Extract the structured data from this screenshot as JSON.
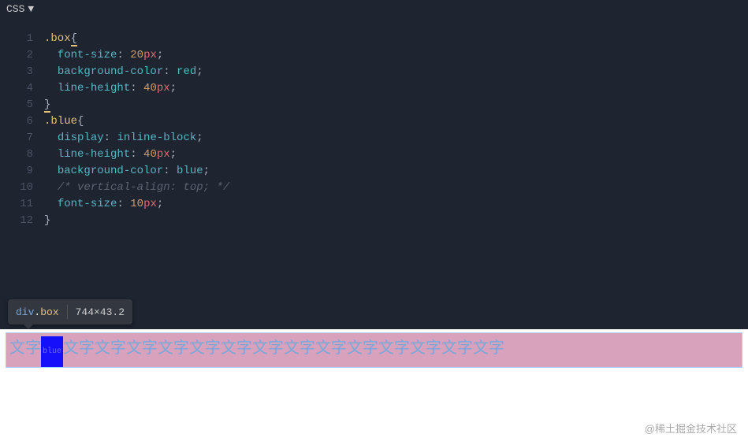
{
  "header": {
    "lang": "CSS",
    "dropdown_icon": "▼"
  },
  "code": {
    "lines_count": 12,
    "l1": {
      "sel": ".box",
      "brace": "{"
    },
    "l2": {
      "prop": "font-size",
      "val_num": "20",
      "val_unit": "px"
    },
    "l3": {
      "prop": "background-color",
      "val": "red"
    },
    "l4": {
      "prop": "line-height",
      "val_num": "40",
      "val_unit": "px"
    },
    "l5": {
      "brace": "}"
    },
    "l6": {
      "sel": ".blue",
      "brace": "{"
    },
    "l7": {
      "prop": "display",
      "val": "inline-block"
    },
    "l8": {
      "prop": "line-height",
      "val_num": "40",
      "val_unit": "px"
    },
    "l9": {
      "prop": "background-color",
      "val": "blue"
    },
    "l10": {
      "comment": "/* vertical-align: top; */"
    },
    "l11": {
      "prop": "font-size",
      "val_num": "10",
      "val_unit": "px"
    },
    "l12": {
      "brace": "}"
    }
  },
  "line_numbers": [
    "1",
    "2",
    "3",
    "4",
    "5",
    "6",
    "7",
    "8",
    "9",
    "10",
    "11",
    "12"
  ],
  "tooltip": {
    "tag": "div",
    "dot": ".",
    "cls": "box",
    "dims": "744×43.2"
  },
  "preview": {
    "text": "文字",
    "blue_label": "blue",
    "repeat_before": 1,
    "repeat_after": 14
  },
  "watermark": "@稀土掘金技术社区"
}
